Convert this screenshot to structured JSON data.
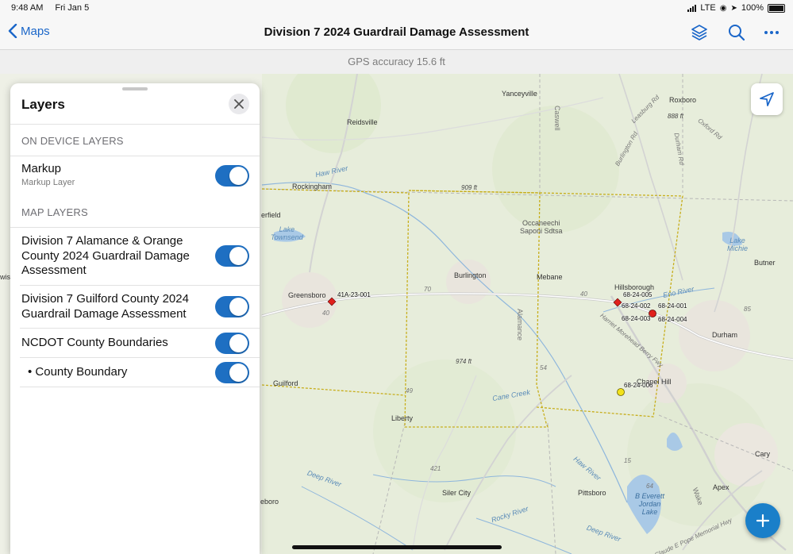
{
  "status": {
    "time": "9:48 AM",
    "date": "Fri Jan 5",
    "network": "LTE",
    "battery": "100%"
  },
  "nav": {
    "back_label": "Maps",
    "title": "Division 7 2024 Guardrail Damage Assessment",
    "icons": [
      "layers-icon",
      "search-icon",
      "more-icon"
    ]
  },
  "gps": {
    "text": "GPS accuracy 15.6 ft"
  },
  "layers_panel": {
    "title": "Layers",
    "on_device_header": "ON DEVICE LAYERS",
    "markup": {
      "name": "Markup",
      "sublabel": "Markup Layer",
      "enabled": true
    },
    "map_layers_header": "MAP LAYERS",
    "layers": [
      {
        "name": "Division 7 Alamance & Orange County 2024 Guardrail Damage Assessment",
        "enabled": true
      },
      {
        "name": "Division 7 Guilford County 2024 Guardrail Damage Assessment",
        "enabled": true
      },
      {
        "name": "NCDOT County Boundaries",
        "enabled": true
      },
      {
        "name": "• County Boundary",
        "enabled": true
      }
    ]
  },
  "map": {
    "towns": {
      "yanceyville": "Yanceyville",
      "roxboro": "Roxboro",
      "reidsville": "Reidsville",
      "caswell": "Caswell",
      "rockingham": "Rockingham",
      "erfield": "erfield",
      "greensboro": "Greensboro",
      "wis": "wis",
      "guilford": "Guilford",
      "burlington": "Burlington",
      "mebane": "Mebane",
      "alamance": "Alamance",
      "hillsborough": "Hillsborough",
      "durham": "Durham",
      "butner": "Butner",
      "chapel_hill": "Chapel Hill",
      "liberty": "Liberty",
      "siler_city": "Siler City",
      "pittsboro": "Pittsboro",
      "apex": "Apex",
      "cary": "Cary",
      "eboro": "eboro",
      "wake": "Wake",
      "occaneechi": "Occaneechi\nSaponi Sdtsa"
    },
    "water": {
      "haw_river_1": "Haw River",
      "lake_townsend": "Lake\nTownsend",
      "lake_michie": "Lake\nMichie",
      "cane_creek": "Cane Creek",
      "haw_river_2": "Haw River",
      "deep_river_1": "Deep River",
      "deep_river_2": "Deep River",
      "rocky_river": "Rocky River",
      "jordan_lake": "B Everett\nJordan\nLake",
      "eno_river": "Eno River"
    },
    "elevations": {
      "e909": "909 ft",
      "e888": "888 ft",
      "e974": "974 ft"
    },
    "roads": {
      "leasburg": "Leasburg Rd",
      "oxford": "Oxford Rd",
      "burlington_rd": "Burlington Rd",
      "durham_rd": "Durham Rd",
      "n40a": "40",
      "n40b": "40",
      "n70": "70",
      "n49": "49",
      "n54": "54",
      "n421": "421",
      "n15": "15",
      "n64": "64",
      "n85": "85",
      "harriet": "Harriet Morehead Berry Fwy",
      "clyde": "Claude E Pope Memorial Hwy"
    },
    "points": [
      {
        "label": "41A-23-001",
        "color": "#e0201c",
        "shape": "diamond"
      },
      {
        "label": "68-24-005",
        "color": "#e0201c",
        "shape": "diamond"
      },
      {
        "label": "68-24-002",
        "color": "#e0201c",
        "shape": "none"
      },
      {
        "label": "68-24-001",
        "color": "#e0201c",
        "shape": "circle"
      },
      {
        "label": "68-24-003",
        "color": "#e0201c",
        "shape": "none"
      },
      {
        "label": "68-24-004",
        "color": "#e0201c",
        "shape": "none"
      },
      {
        "label": "68-24-006",
        "color": "#f2e21a",
        "shape": "circle"
      }
    ]
  },
  "colors": {
    "accent": "#1a66c9",
    "toggle_on": "#1e6fc2",
    "boundary": "#d8c13a",
    "fab": "#1a7fc9"
  }
}
